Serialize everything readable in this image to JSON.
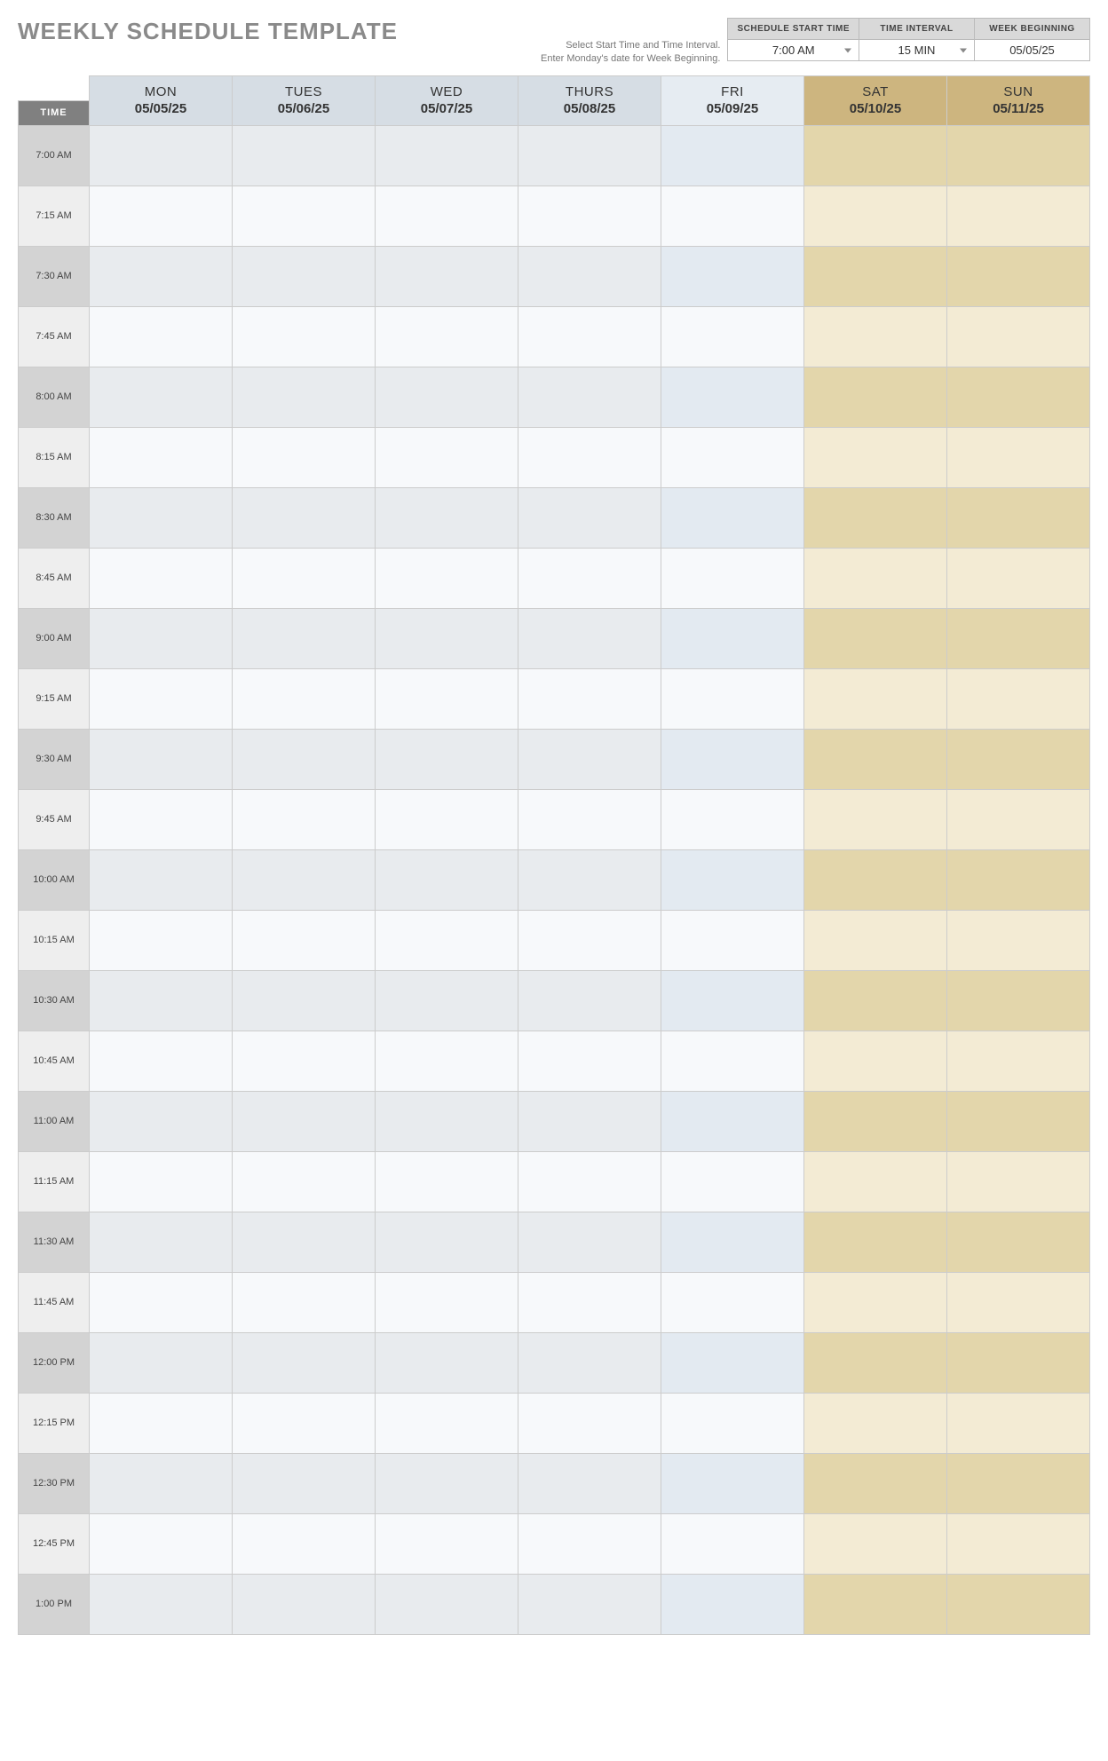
{
  "title": "WEEKLY SCHEDULE TEMPLATE",
  "help_line1": "Select Start Time and Time Interval.",
  "help_line2": "Enter Monday's date for Week Beginning.",
  "controls": {
    "start_time_label": "SCHEDULE START TIME",
    "start_time_value": "7:00 AM",
    "interval_label": "TIME INTERVAL",
    "interval_value": "15 MIN",
    "week_begin_label": "WEEK BEGINNING",
    "week_begin_value": "05/05/25"
  },
  "time_header": "TIME",
  "days": [
    {
      "name": "MON",
      "date": "05/05/25",
      "cls": "weekday-hdr",
      "bodycls": "wk"
    },
    {
      "name": "TUES",
      "date": "05/06/25",
      "cls": "weekday-hdr",
      "bodycls": "wk"
    },
    {
      "name": "WED",
      "date": "05/07/25",
      "cls": "weekday-hdr",
      "bodycls": "wk"
    },
    {
      "name": "THURS",
      "date": "05/08/25",
      "cls": "weekday-hdr",
      "bodycls": "wk"
    },
    {
      "name": "FRI",
      "date": "05/09/25",
      "cls": "fri-hdr",
      "bodycls": "fr"
    },
    {
      "name": "SAT",
      "date": "05/10/25",
      "cls": "weekend-hdr",
      "bodycls": "we1"
    },
    {
      "name": "SUN",
      "date": "05/11/25",
      "cls": "weekend-hdr",
      "bodycls": "we2"
    }
  ],
  "times": [
    "7:00 AM",
    "7:15 AM",
    "7:30 AM",
    "7:45 AM",
    "8:00 AM",
    "8:15 AM",
    "8:30 AM",
    "8:45 AM",
    "9:00 AM",
    "9:15 AM",
    "9:30 AM",
    "9:45 AM",
    "10:00 AM",
    "10:15 AM",
    "10:30 AM",
    "10:45 AM",
    "11:00 AM",
    "11:15 AM",
    "11:30 AM",
    "11:45 AM",
    "12:00 PM",
    "12:15 PM",
    "12:30 PM",
    "12:45 PM",
    "1:00 PM"
  ]
}
